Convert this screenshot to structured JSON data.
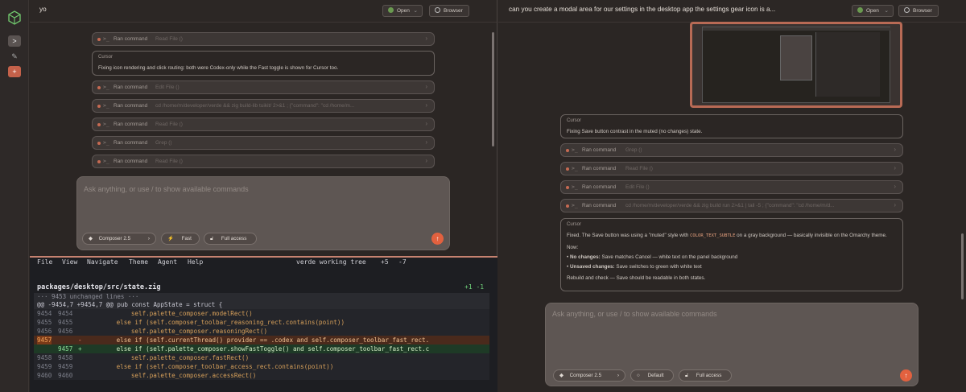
{
  "left_title": "yo",
  "right_title": "can you create a modal area for our settings in the desktop app the settings gear icon is a...",
  "header": {
    "open_label": "Open",
    "browser_label": "Browser"
  },
  "rail": {
    "buttons": [
      ">",
      "✎",
      "+"
    ]
  },
  "left": {
    "cards": [
      {
        "label": "Ran command",
        "sub": "Read File ()"
      },
      {
        "label": "Ran command",
        "sub": "Edit File ()"
      },
      {
        "label": "Ran command",
        "sub": "cd /home/m/developer/verde && zig build-lib tuikit/ 2>&1 ; {\"command\": \"cd /home/m..."
      },
      {
        "label": "Ran command",
        "sub": "Read File ()"
      },
      {
        "label": "Ran command",
        "sub": "Grep ()"
      },
      {
        "label": "Ran command",
        "sub": "Read File ()"
      }
    ],
    "message": {
      "who": "Cursor",
      "text": "Fixing icon rendering and click routing: both were Codex-only while the Fast toggle is shown for Cursor too."
    },
    "composer": {
      "placeholder": "Ask anything, or use / to show available commands",
      "model": "Composer 2.5",
      "speed": "Fast",
      "access": "Full access"
    }
  },
  "right": {
    "message1": {
      "who": "Cursor",
      "text": "Fixing Save button contrast in the muted (no changes) state."
    },
    "cards": [
      {
        "label": "Ran command",
        "sub": "Grep ()"
      },
      {
        "label": "Ran command",
        "sub": "Read File ()"
      },
      {
        "label": "Ran command",
        "sub": "Edit File ()"
      },
      {
        "label": "Ran command",
        "sub": "cd /home/m/developer/verde && zig build run 2>&1 | tail -5 ; {\"command\": \"cd /home/m/d..."
      }
    ],
    "message2": {
      "who": "Cursor",
      "p1_a": "Fixed. The Save button was using a \"muted\" style with ",
      "p1_code": "COLOR_TEXT_SUBTLE",
      "p1_b": " on a gray background — basically invisible on the Omarchy theme.",
      "now": "Now:",
      "b1_bold": "No changes:",
      "b1_text": " Save matches Cancel — white text on the panel background",
      "b2_bold": "Unsaved changes:",
      "b2_text": " Save switches to green with white text",
      "p3": "Rebuild and check — Save should be readable in both states."
    },
    "composer": {
      "placeholder": "Ask anything, or use / to show available commands",
      "model": "Composer 2.5",
      "speed": "Default",
      "access": "Full access"
    }
  },
  "terminal": {
    "menu": [
      "File",
      "View",
      "Navigate",
      "Theme",
      "Agent",
      "Help"
    ],
    "status": "verde working tree",
    "plus": "+5",
    "minus": "-7",
    "file": "packages/desktop/src/state.zig",
    "file_stats": "+1 -1",
    "unchanged": "··· 9453 unchanged lines ···",
    "hunk": "@@ -9454,7 +9454,7 @@ pub const AppState = struct {",
    "lines": [
      {
        "old": "9454",
        "new": "9454",
        "mark": "",
        "code": "            self.palette_composer.modelRect()",
        "kind": "ctx"
      },
      {
        "old": "9455",
        "new": "9455",
        "mark": "",
        "code": "        else if (self.composer_toolbar_reasoning_rect.contains(point))",
        "kind": "ctx"
      },
      {
        "old": "9456",
        "new": "9456",
        "mark": "",
        "code": "            self.palette_composer.reasoningRect()",
        "kind": "ctx"
      },
      {
        "old": "9457",
        "new": "",
        "mark": "-",
        "code": "        else if (self.currentThread() provider == .codex and self.composer_toolbar_fast_rect.",
        "kind": "del"
      },
      {
        "old": "",
        "new": "9457",
        "mark": "+",
        "code": "        else if (self.palette_composer.showFastToggle() and self.composer_toolbar_fast_rect.c",
        "kind": "add"
      },
      {
        "old": "9458",
        "new": "9458",
        "mark": "",
        "code": "            self.palette_composer.fastRect()",
        "kind": "ctx"
      },
      {
        "old": "9459",
        "new": "9459",
        "mark": "",
        "code": "        else if (self.composer_toolbar_access_rect.contains(point))",
        "kind": "ctx"
      },
      {
        "old": "9460",
        "new": "9460",
        "mark": "",
        "code": "            self.palette_composer.accessRect()",
        "kind": "ctx"
      }
    ]
  },
  "colors": {
    "accent": "#e2613f",
    "bg": "#2b2624",
    "card": "#3d3735",
    "terminal_bg": "#1d1e22",
    "diff_add": "#1e3a26",
    "diff_del": "#4a2a1c"
  }
}
